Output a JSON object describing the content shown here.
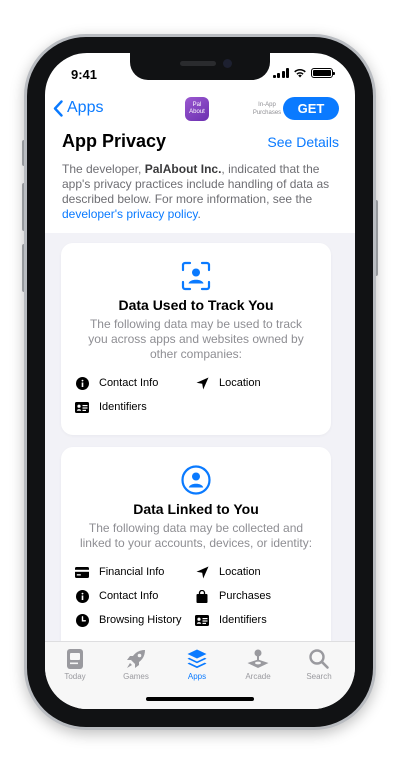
{
  "status": {
    "time": "9:41"
  },
  "nav": {
    "back_label": "Apps",
    "app_icon_text": "Pal About",
    "in_app_label": "In-App Purchases",
    "get_label": "GET"
  },
  "privacy": {
    "title": "App Privacy",
    "see_details": "See Details",
    "intro_prefix": "The developer, ",
    "developer": "PalAbout Inc.",
    "intro_middle": ", indicated that the app's privacy practices include handling of data as described below. For more information, see the ",
    "policy_link": "developer's privacy policy",
    "intro_suffix": "."
  },
  "cards": [
    {
      "title": "Data Used to Track You",
      "description": "The following data may be used to track you across apps and websites owned by other companies:",
      "items": [
        "Contact Info",
        "Location",
        "Identifiers"
      ]
    },
    {
      "title": "Data Linked to You",
      "description": "The following data may be collected and linked to your accounts, devices, or identity:",
      "items": [
        "Financial Info",
        "Location",
        "Contact Info",
        "Purchases",
        "Browsing History",
        "Identifiers"
      ]
    }
  ],
  "tabs": [
    {
      "label": "Today",
      "icon": "today-icon"
    },
    {
      "label": "Games",
      "icon": "rocket-icon"
    },
    {
      "label": "Apps",
      "icon": "stack-icon",
      "active": true
    },
    {
      "label": "Arcade",
      "icon": "joystick-icon"
    },
    {
      "label": "Search",
      "icon": "magnifier-icon"
    }
  ],
  "colors": {
    "accent": "#0a7aff",
    "app_icon": "#8a45c6",
    "tab_inactive": "#9a9a9f"
  }
}
